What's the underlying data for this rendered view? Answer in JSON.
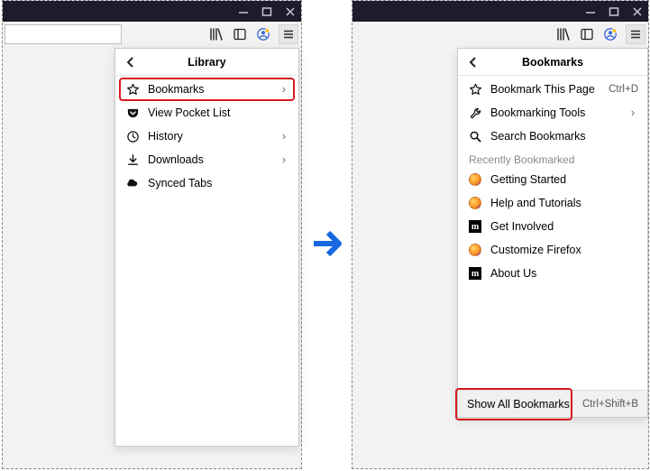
{
  "left": {
    "panel_title": "Library",
    "items": [
      {
        "label": "Bookmarks",
        "icon": "star-icon",
        "chevron": "›"
      },
      {
        "label": "View Pocket List",
        "icon": "pocket-icon",
        "chevron": ""
      },
      {
        "label": "History",
        "icon": "clock-icon",
        "chevron": "›"
      },
      {
        "label": "Downloads",
        "icon": "download-icon",
        "chevron": "›"
      },
      {
        "label": "Synced Tabs",
        "icon": "sync-icon",
        "chevron": ""
      }
    ]
  },
  "right": {
    "panel_title": "Bookmarks",
    "items": [
      {
        "label": "Bookmark This Page",
        "icon": "star-icon",
        "shortcut": "Ctrl+D"
      },
      {
        "label": "Bookmarking Tools",
        "icon": "wrench-icon",
        "chevron": "›"
      },
      {
        "label": "Search Bookmarks",
        "icon": "search-icon"
      }
    ],
    "recent_label": "Recently Bookmarked",
    "recent": [
      {
        "label": "Getting Started",
        "icon": "firefox"
      },
      {
        "label": "Help and Tutorials",
        "icon": "firefox"
      },
      {
        "label": "Get Involved",
        "icon": "m"
      },
      {
        "label": "Customize Firefox",
        "icon": "firefox"
      },
      {
        "label": "About Us",
        "icon": "m"
      }
    ],
    "footer": {
      "label": "Show All Bookmarks",
      "shortcut": "Ctrl+Shift+B"
    }
  }
}
